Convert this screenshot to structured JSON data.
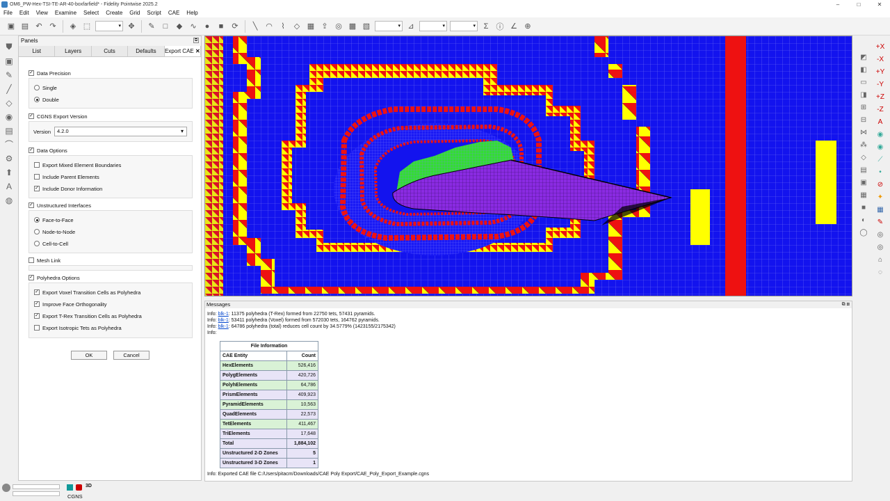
{
  "window": {
    "title": "OM6_PW-Hex-TSI-TE-AR-40-boxfarfield* - Fidelity Pointwise 2025.2",
    "min": "–",
    "max": "□",
    "close": "✕"
  },
  "menu": [
    "File",
    "Edit",
    "View",
    "Examine",
    "Select",
    "Create",
    "Grid",
    "Script",
    "CAE",
    "Help"
  ],
  "panels": {
    "title": "Panels",
    "tabs": [
      "List",
      "Layers",
      "Cuts",
      "Defaults",
      "Export CAE"
    ],
    "data_precision": {
      "label": "Data Precision",
      "checked": true,
      "options": [
        "Single",
        "Double"
      ],
      "selected": "Double"
    },
    "cgns_export_version": {
      "label": "CGNS Export Version",
      "checked": true,
      "version_label": "Version",
      "version_value": "4.2.0"
    },
    "data_options": {
      "label": "Data Options",
      "checked": true,
      "items": [
        {
          "label": "Export Mixed Element Boundaries",
          "checked": false
        },
        {
          "label": "Include Parent Elements",
          "checked": false
        },
        {
          "label": "Include Donor Information",
          "checked": true
        }
      ]
    },
    "unstructured_interfaces": {
      "label": "Unstructured Interfaces",
      "checked": true,
      "options": [
        "Face-to-Face",
        "Node-to-Node",
        "Cell-to-Cell"
      ],
      "selected": "Face-to-Face"
    },
    "mesh_link": {
      "label": "Mesh Link",
      "checked": false
    },
    "polyhedra_options": {
      "label": "Polyhedra Options",
      "checked": true,
      "items": [
        {
          "label": "Export Voxel Transition Cells as Polyhedra",
          "checked": true
        },
        {
          "label": "Improve Face Orthogonality",
          "checked": true
        },
        {
          "label": "Export T-Rex Transition Cells as Polyhedra",
          "checked": true
        },
        {
          "label": "Export Isotropic Tets as Polyhedra",
          "checked": false
        }
      ]
    },
    "ok": "OK",
    "cancel": "Cancel"
  },
  "messages": {
    "title": "Messages",
    "lines": [
      {
        "prefix": "Info: ",
        "link": "blk-1",
        "text": ": 11375 polyhedra (T-Rex) formed from 22750 tets, 57431 pyramids."
      },
      {
        "prefix": "Info: ",
        "link": "blk-1",
        "text": ": 53411 polyhedra (Voxel) formed from 572030 tets, 164762 pyramids."
      },
      {
        "prefix": "Info: ",
        "link": "blk-1",
        "text": ": 64786 polyhedra (total) reduces cell count by 34.5779% (1423155/2175342)"
      },
      {
        "prefix": "Info:",
        "link": "",
        "text": ""
      }
    ],
    "file_info": {
      "title": "File Information",
      "headers": [
        "CAE Entity",
        "Count"
      ],
      "rows": [
        {
          "entity": "HexElements",
          "count": "526,416",
          "tone": "g"
        },
        {
          "entity": "PolygElements",
          "count": "420,726",
          "tone": "p"
        },
        {
          "entity": "PolyhElements",
          "count": "64,786",
          "tone": "g"
        },
        {
          "entity": "PrismElements",
          "count": "409,923",
          "tone": "p"
        },
        {
          "entity": "PyramidElements",
          "count": "10,563",
          "tone": "g"
        },
        {
          "entity": "QuadElements",
          "count": "22,573",
          "tone": "p"
        },
        {
          "entity": "TetElements",
          "count": "411,467",
          "tone": "g"
        },
        {
          "entity": "TriElements",
          "count": "17,648",
          "tone": "p"
        },
        {
          "entity": "Total",
          "count": "1,884,102",
          "tone": "p"
        },
        {
          "entity": "Unstructured 2-D Zones",
          "count": "5",
          "tone": "p"
        },
        {
          "entity": "Unstructured 3-D Zones",
          "count": "1",
          "tone": "p"
        }
      ]
    },
    "final_line": "Info: Exported CAE file C:/Users/pitacm/Downloads/CAE Poly Export/CAE_Poly_Export_Example.cgns"
  },
  "status": {
    "solver": "CGNS",
    "dim": "3D"
  },
  "colors": {
    "mesh_blue": "#1313ee",
    "mesh_red": "#ee1111",
    "mesh_yellow": "#ffff00",
    "wing_purple": "#8a2be2",
    "green": "#33dd33"
  }
}
